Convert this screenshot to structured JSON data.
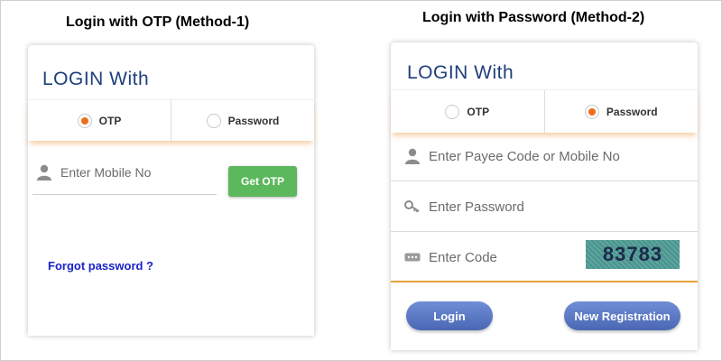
{
  "method1": {
    "heading": "Login with OTP (Method-1)",
    "title": "LOGIN With",
    "options": [
      {
        "label": "OTP",
        "selected": true
      },
      {
        "label": "Password",
        "selected": false
      }
    ],
    "mobile_placeholder": "Enter Mobile No",
    "get_otp_label": "Get OTP",
    "forgot_label": "Forgot password ?"
  },
  "method2": {
    "heading": "Login with Password (Method-2)",
    "title": "LOGIN With",
    "options": [
      {
        "label": "OTP",
        "selected": false
      },
      {
        "label": "Password",
        "selected": true
      }
    ],
    "payee_placeholder": "Enter Payee Code or Mobile No",
    "password_placeholder": "Enter Password",
    "code_placeholder": "Enter Code",
    "captcha_text": "83783",
    "login_label": "Login",
    "register_label": "New Registration"
  },
  "colors": {
    "title": "#1f3f7a",
    "radio_selected": "#ef6c1c",
    "get_otp": "#5cb85c",
    "link": "#1a23c8",
    "pill": "#4b67b4"
  },
  "icons": {
    "user": "user-icon",
    "key": "key-icon",
    "code": "code-icon"
  }
}
